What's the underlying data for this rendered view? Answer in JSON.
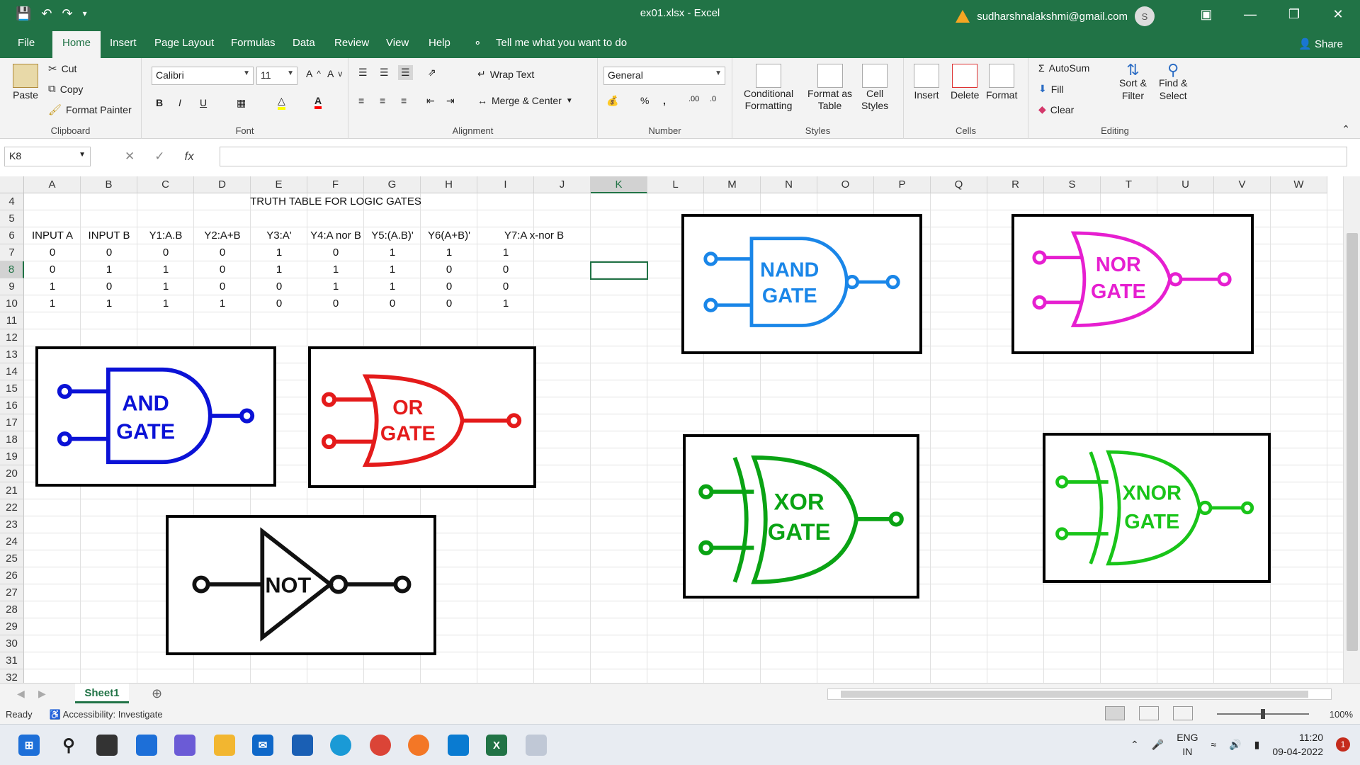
{
  "title_bar": {
    "doc_title": "ex01.xlsx  -  Excel",
    "account_email": "sudharshnalakshmi@gmail.com",
    "avatar_initial": "S"
  },
  "ribbon_tabs": {
    "file": "File",
    "home": "Home",
    "insert": "Insert",
    "page_layout": "Page Layout",
    "formulas": "Formulas",
    "data": "Data",
    "review": "Review",
    "view": "View",
    "help": "Help",
    "tell_me": "Tell me what you want to do",
    "share": "Share"
  },
  "clipboard": {
    "paste": "Paste",
    "cut": "Cut",
    "copy": "Copy",
    "format_painter": "Format Painter",
    "label": "Clipboard"
  },
  "font": {
    "name": "Calibri",
    "size": "11",
    "label": "Font"
  },
  "alignment": {
    "wrap_text": "Wrap Text",
    "merge_center": "Merge & Center",
    "label": "Alignment"
  },
  "number": {
    "format": "General",
    "label": "Number"
  },
  "styles": {
    "conditional_1": "Conditional",
    "conditional_2": "Formatting",
    "format_table_1": "Format as",
    "format_table_2": "Table",
    "cell_styles_1": "Cell",
    "cell_styles_2": "Styles",
    "label": "Styles"
  },
  "cells_group": {
    "insert": "Insert",
    "delete": "Delete",
    "format": "Format",
    "label": "Cells"
  },
  "editing": {
    "autosum": "AutoSum",
    "fill": "Fill",
    "clear": "Clear",
    "sort_1": "Sort &",
    "sort_2": "Filter",
    "find_1": "Find &",
    "find_2": "Select",
    "label": "Editing"
  },
  "formula_bar": {
    "name_box": "K8",
    "formula": ""
  },
  "columns": [
    "A",
    "B",
    "C",
    "D",
    "E",
    "F",
    "G",
    "H",
    "I",
    "J",
    "K",
    "L",
    "M",
    "N",
    "O",
    "P",
    "Q",
    "R",
    "S",
    "T",
    "U",
    "V",
    "W"
  ],
  "rows": [
    "4",
    "5",
    "6",
    "7",
    "8",
    "9",
    "10",
    "11",
    "12",
    "13",
    "14",
    "15",
    "16",
    "17",
    "18",
    "19",
    "20",
    "21",
    "22",
    "23",
    "24",
    "25",
    "26",
    "27",
    "28",
    "29",
    "30",
    "31",
    "32"
  ],
  "sheet": {
    "title": "TRUTH TABLE FOR LOGIC GATES",
    "headers": [
      "INPUT A",
      "INPUT B",
      "Y1:A.B",
      "Y2:A+B",
      "Y3:A'",
      "Y4:A nor B",
      "Y5:(A.B)'",
      "Y6(A+B)'",
      "Y7:A x-nor B"
    ],
    "data": [
      [
        "0",
        "0",
        "0",
        "0",
        "1",
        "0",
        "1",
        "1",
        "1"
      ],
      [
        "0",
        "1",
        "1",
        "0",
        "1",
        "1",
        "1",
        "0",
        "0"
      ],
      [
        "1",
        "0",
        "1",
        "0",
        "0",
        "1",
        "1",
        "0",
        "0"
      ],
      [
        "1",
        "1",
        "1",
        "1",
        "0",
        "0",
        "0",
        "0",
        "1"
      ]
    ]
  },
  "gates": {
    "and": [
      "AND",
      "GATE"
    ],
    "or": [
      "OR",
      "GATE"
    ],
    "not": [
      "NOT"
    ],
    "nand": [
      "NAND",
      "GATE"
    ],
    "nor": [
      "NOR",
      "GATE"
    ],
    "xor": [
      "XOR",
      "GATE"
    ],
    "xnor": [
      "XNOR",
      "GATE"
    ]
  },
  "colors": {
    "and": "#0b12d6",
    "or": "#e41b1b",
    "not": "#111111",
    "nand": "#1a86e8",
    "nor": "#e61fd0",
    "xor": "#0aa314",
    "xnor": "#19c419",
    "excel_green": "#217346"
  },
  "sheet_tab": "Sheet1",
  "status": {
    "ready": "Ready",
    "accessibility": "Accessibility: Investigate",
    "zoom": "100%"
  },
  "taskbar": {
    "lang_1": "ENG",
    "lang_2": "IN",
    "time": "11:20",
    "date": "09-04-2022",
    "notifications": "1"
  }
}
